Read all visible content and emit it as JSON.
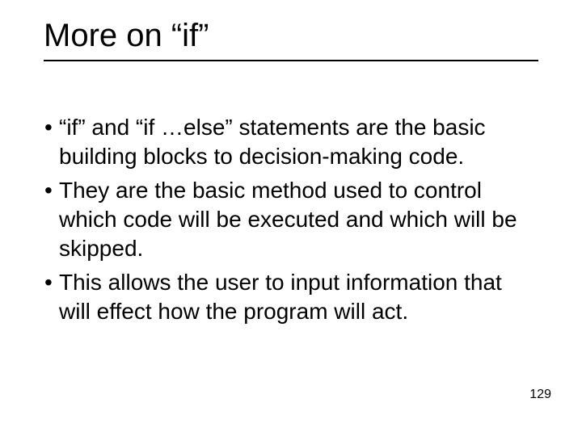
{
  "title": "More on “if”",
  "bullets": [
    "“if” and “if …else” statements are the basic building blocks to decision-making code.",
    "They are the basic method used to control which code will be executed and which will be skipped.",
    "This allows the user to input information that will effect how the program will act."
  ],
  "page_number": "129"
}
